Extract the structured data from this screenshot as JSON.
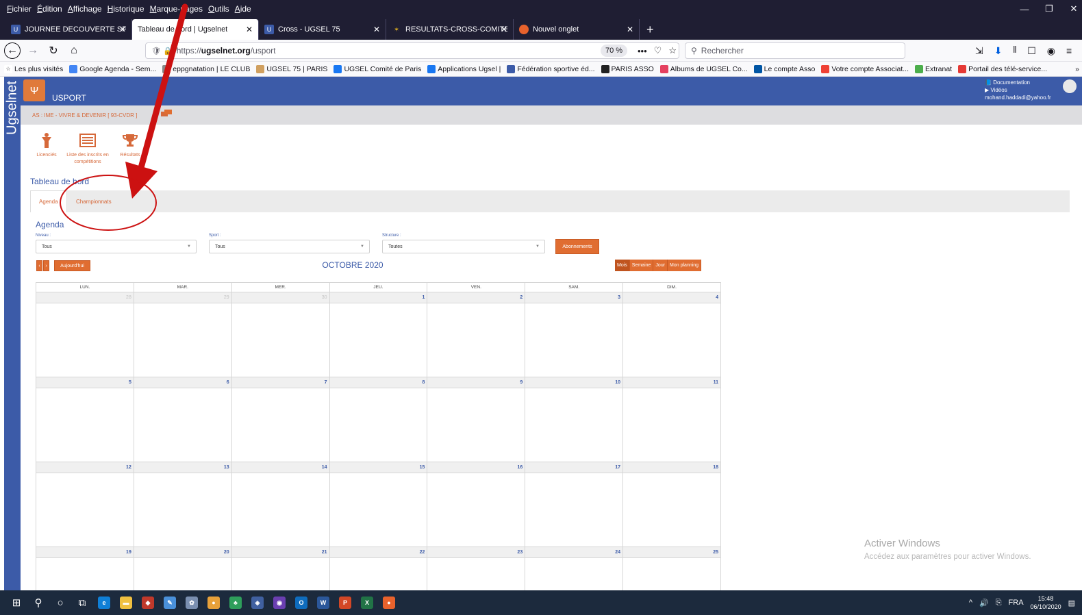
{
  "menubar": {
    "items": [
      "Fichier",
      "Édition",
      "Affichage",
      "Historique",
      "Marque-pages",
      "Outils",
      "Aide"
    ]
  },
  "window_controls": {
    "minimize": "—",
    "restore": "❐",
    "close": "✕"
  },
  "tabs": [
    {
      "label": "JOURNEE DECOUVERTE SPORTI",
      "close": "✕"
    },
    {
      "label": "Tableau de bord | Ugselnet",
      "close": "✕"
    },
    {
      "label": "Cross - UGSEL 75",
      "close": "✕"
    },
    {
      "label": "RESULTATS-CROSS-COMITE-DE",
      "close": "✕"
    },
    {
      "label": "Nouvel onglet",
      "close": "✕"
    }
  ],
  "newtab_symbol": "+",
  "navbar": {
    "back": "←",
    "forward": "→",
    "reload": "↻",
    "home": "⌂",
    "url_prefix": "https://",
    "url_host": "ugselnet.org",
    "url_path": "/usport",
    "zoom": "70 %",
    "more": "•••",
    "pocket": "♡",
    "star": "☆",
    "search_placeholder": "Rechercher",
    "toolbar_icons": [
      "⇲",
      "⬇",
      "𝍪",
      "☐",
      "◉",
      "≡"
    ]
  },
  "bookmarks": [
    {
      "label": "Les plus visités",
      "color": "#ffffff"
    },
    {
      "label": "Google Agenda - Sem...",
      "color": "#4285f4"
    },
    {
      "label": "eppgnatation | LE CLUB",
      "color": "#888888"
    },
    {
      "label": "UGSEL 75 | PARIS",
      "color": "#d0a060"
    },
    {
      "label": "UGSEL Comité de Paris",
      "color": "#1877f2"
    },
    {
      "label": "Applications Ugsel |",
      "color": "#1877f2"
    },
    {
      "label": "Fédération sportive éd...",
      "color": "#3c5ba8"
    },
    {
      "label": "PARIS ASSO",
      "color": "#222222"
    },
    {
      "label": "Albums de UGSEL Co...",
      "color": "#e4405f"
    },
    {
      "label": "Le compte Asso",
      "color": "#0055a4"
    },
    {
      "label": "Votre compte Associat...",
      "color": "#ef4135"
    },
    {
      "label": "Extranat",
      "color": "#4cae4c"
    },
    {
      "label": "Portail des télé-service...",
      "color": "#e53935"
    }
  ],
  "app": {
    "rail_text": "Ugselnet",
    "logo_glyph": "Ψ",
    "name": "USPORT",
    "links": [
      "Documentation",
      "Vidéos"
    ],
    "email": "mohand.haddadi@yahoo.fr",
    "as_label": "AS : IME - VIVRE & DEVENIR [ 93-CVDR ]"
  },
  "quick_links": [
    {
      "label": "Licenciés",
      "icon": "person-icon",
      "glyph": "✦"
    },
    {
      "label": "Liste des inscrits en compétitions",
      "icon": "list-icon",
      "glyph": "▤"
    },
    {
      "label": "Résultats",
      "icon": "trophy-icon",
      "glyph": "🏆"
    }
  ],
  "page_title": "Tableau de bord",
  "page_tabs": [
    "Agenda",
    "Championnats"
  ],
  "agenda": {
    "section_title": "Agenda",
    "filters": [
      {
        "label": "Niveau :",
        "value": "Tous"
      },
      {
        "label": "Sport :",
        "value": "Tous"
      },
      {
        "label": "Structure :",
        "value": "Toutes"
      }
    ],
    "subscribe_btn": "Abonnements",
    "prev": "‹",
    "next": "›",
    "today_btn": "Aujourd'hui",
    "month_title": "OCTOBRE 2020",
    "views": [
      "Mois",
      "Semaine",
      "Jour",
      "Mon planning"
    ],
    "active_view": "Mois",
    "weekdays": [
      "LUN.",
      "MAR.",
      "MER.",
      "JEU.",
      "VEN.",
      "SAM.",
      "DIM."
    ],
    "weeks": [
      [
        "28",
        "29",
        "30",
        "1",
        "2",
        "3",
        "4"
      ],
      [
        "5",
        "6",
        "7",
        "8",
        "9",
        "10",
        "11"
      ],
      [
        "12",
        "13",
        "14",
        "15",
        "16",
        "17",
        "18"
      ],
      [
        "19",
        "20",
        "21",
        "22",
        "23",
        "24",
        "25"
      ]
    ],
    "other_month_days": [
      "28",
      "29",
      "30"
    ]
  },
  "watermark": {
    "title": "Activer Windows",
    "subtitle": "Accédez aux paramètres pour activer Windows."
  },
  "annotation": {
    "color": "#cc1111"
  },
  "taskbar": {
    "apps": [
      {
        "name": "windows-start-icon",
        "glyph": "⊞",
        "color": ""
      },
      {
        "name": "search-icon",
        "glyph": "⚲",
        "color": ""
      },
      {
        "name": "cortana-icon",
        "glyph": "○",
        "color": ""
      },
      {
        "name": "task-view-icon",
        "glyph": "⧉",
        "color": ""
      },
      {
        "name": "edge-icon",
        "glyph": "e",
        "color": "#0f7fd6"
      },
      {
        "name": "file-explorer-icon",
        "glyph": "▬",
        "color": "#f0c040"
      },
      {
        "name": "app-icon-1",
        "glyph": "◆",
        "color": "#c0392b"
      },
      {
        "name": "paint-icon",
        "glyph": "✎",
        "color": "#4a90d9"
      },
      {
        "name": "app-icon-2",
        "glyph": "✿",
        "color": "#7a8fb0"
      },
      {
        "name": "chrome-icon",
        "glyph": "●",
        "color": "#e8a13a"
      },
      {
        "name": "app-icon-3",
        "glyph": "♣",
        "color": "#2e9e5b"
      },
      {
        "name": "app-icon-4",
        "glyph": "◈",
        "color": "#4060a0"
      },
      {
        "name": "app-icon-5",
        "glyph": "◉",
        "color": "#6a3fb0"
      },
      {
        "name": "outlook-icon",
        "glyph": "O",
        "color": "#0f6cbd"
      },
      {
        "name": "word-icon",
        "glyph": "W",
        "color": "#2b579a"
      },
      {
        "name": "powerpoint-icon",
        "glyph": "P",
        "color": "#d24726"
      },
      {
        "name": "excel-icon",
        "glyph": "X",
        "color": "#217346"
      },
      {
        "name": "firefox-icon",
        "glyph": "●",
        "color": "#e8622c"
      }
    ],
    "tray": {
      "chevron": "^",
      "volume": "🔊",
      "network": "⎘",
      "lang": "FRA",
      "time": "15:48",
      "date": "06/10/2020",
      "notifications": "▤"
    }
  }
}
